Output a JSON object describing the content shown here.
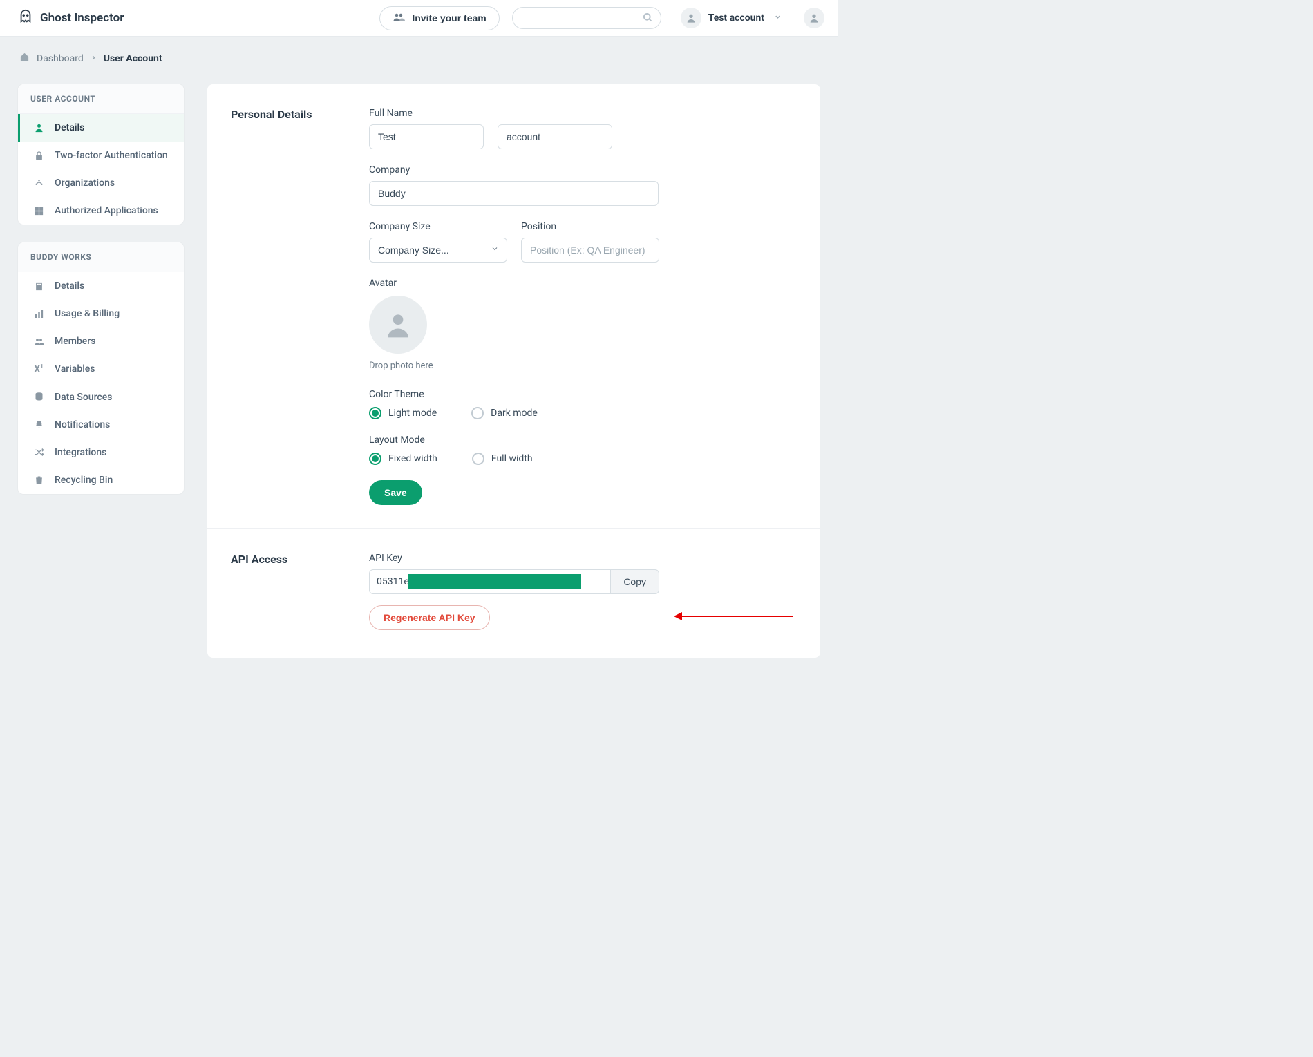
{
  "header": {
    "product_name": "Ghost Inspector",
    "invite_label": "Invite your team",
    "account_name": "Test account"
  },
  "breadcrumb": {
    "root": "Dashboard",
    "current": "User Account"
  },
  "sidebar": {
    "group1_title": "USER ACCOUNT",
    "group1_items": [
      "Details",
      "Two-factor Authentication",
      "Organizations",
      "Authorized Applications"
    ],
    "group2_title": "BUDDY WORKS",
    "group2_items": [
      "Details",
      "Usage & Billing",
      "Members",
      "Variables",
      "Data Sources",
      "Notifications",
      "Integrations",
      "Recycling Bin"
    ]
  },
  "personal": {
    "section_title": "Personal Details",
    "full_name_label": "Full Name",
    "first_name": "Test",
    "last_name": "account",
    "company_label": "Company",
    "company_value": "Buddy",
    "company_size_label": "Company Size",
    "company_size_placeholder": "Company Size...",
    "position_label": "Position",
    "position_placeholder": "Position (Ex: QA Engineer)",
    "avatar_label": "Avatar",
    "avatar_drop_text": "Drop photo here",
    "color_theme_label": "Color Theme",
    "light_mode": "Light mode",
    "dark_mode": "Dark mode",
    "layout_mode_label": "Layout Mode",
    "fixed_width": "Fixed width",
    "full_width": "Full width",
    "save_label": "Save"
  },
  "api": {
    "section_title": "API Access",
    "key_label": "API Key",
    "key_prefix": "05311e",
    "copy_label": "Copy",
    "regenerate_label": "Regenerate API Key"
  }
}
